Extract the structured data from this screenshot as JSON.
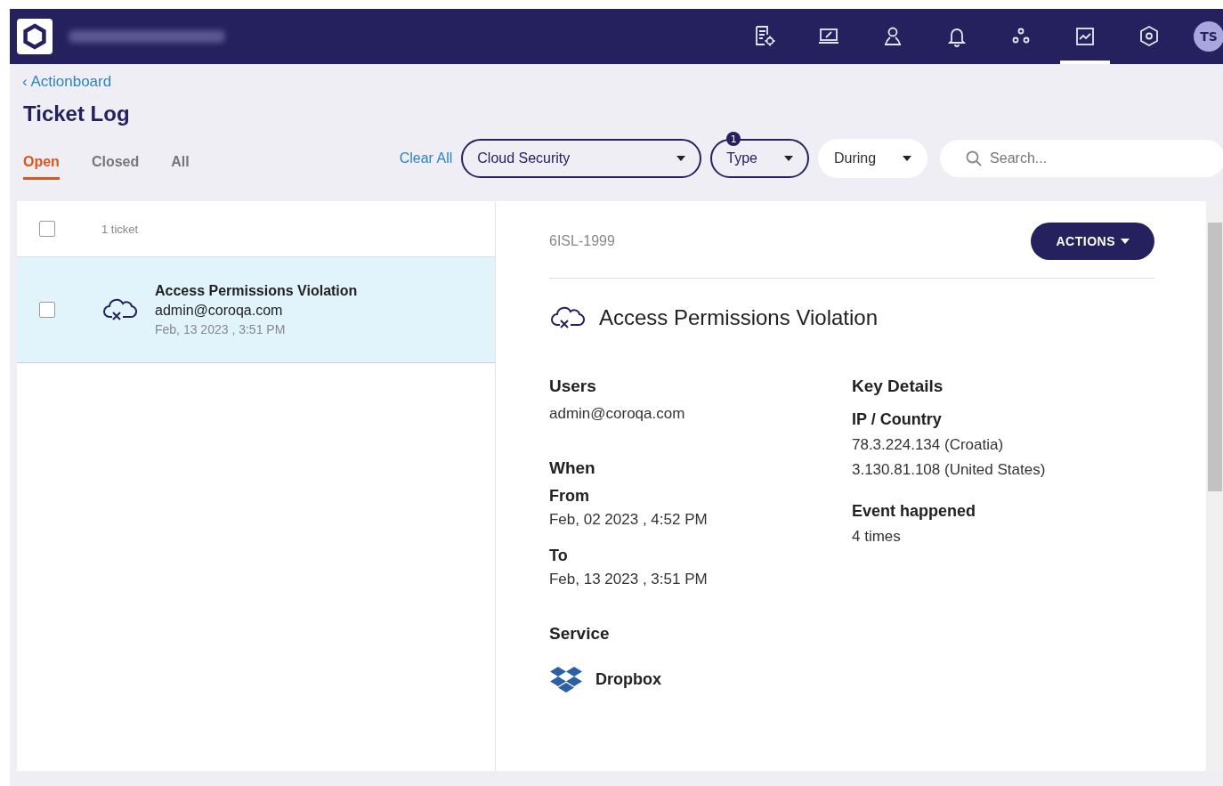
{
  "nav": [
    {
      "kind": "report-settings",
      "selected": false
    },
    {
      "kind": "laptop",
      "selected": false
    },
    {
      "kind": "user",
      "selected": false
    },
    {
      "kind": "bell",
      "selected": false
    },
    {
      "kind": "nodes",
      "selected": false
    },
    {
      "kind": "chart",
      "selected": true
    },
    {
      "kind": "hexagon",
      "selected": false
    }
  ],
  "avatar": "TS",
  "breadcrumb": {
    "icon": "‹",
    "label": "Actionboard"
  },
  "title": "Ticket Log",
  "tabs": [
    {
      "label": "Open",
      "selected": true
    },
    {
      "label": "Closed",
      "selected": false
    },
    {
      "label": "All",
      "selected": false
    }
  ],
  "clear_all": "Clear All",
  "filters": [
    {
      "label": "Cloud Security",
      "applied": true
    },
    {
      "label": "Type",
      "applied": true,
      "badge": "1"
    },
    {
      "label": "During",
      "applied": false
    }
  ],
  "search": {
    "placeholder": "Search..."
  },
  "list": {
    "select_all_checked": false,
    "count": "1 ticket",
    "tickets": [
      {
        "title": "Access Permissions Violation",
        "user": "admin@coroqa.com",
        "time": "Feb, 13 2023 , 3:51 PM",
        "checked": false,
        "selected": true
      }
    ]
  },
  "detail": {
    "id": "6ISL-1999",
    "actions": "ACTIONS",
    "title": "Access Permissions Violation",
    "left": [
      {
        "heading": "Users",
        "items": [
          {
            "value": "admin@coroqa.com"
          }
        ]
      },
      {
        "heading": "When",
        "items": [
          {
            "label": "From",
            "value": "Feb, 02 2023 , 4:52 PM"
          },
          {
            "label": "To",
            "value": "Feb, 13 2023 , 3:51 PM"
          }
        ]
      }
    ],
    "right": {
      "heading": "Key Details",
      "items": [
        {
          "label": "IP / Country",
          "values": [
            "78.3.224.134 (Croatia)",
            "3.130.81.108 (United States)"
          ]
        },
        {
          "label": "Event happened",
          "values": [
            "4 times"
          ]
        }
      ]
    },
    "service": {
      "heading": "Service",
      "name": "Dropbox"
    }
  }
}
